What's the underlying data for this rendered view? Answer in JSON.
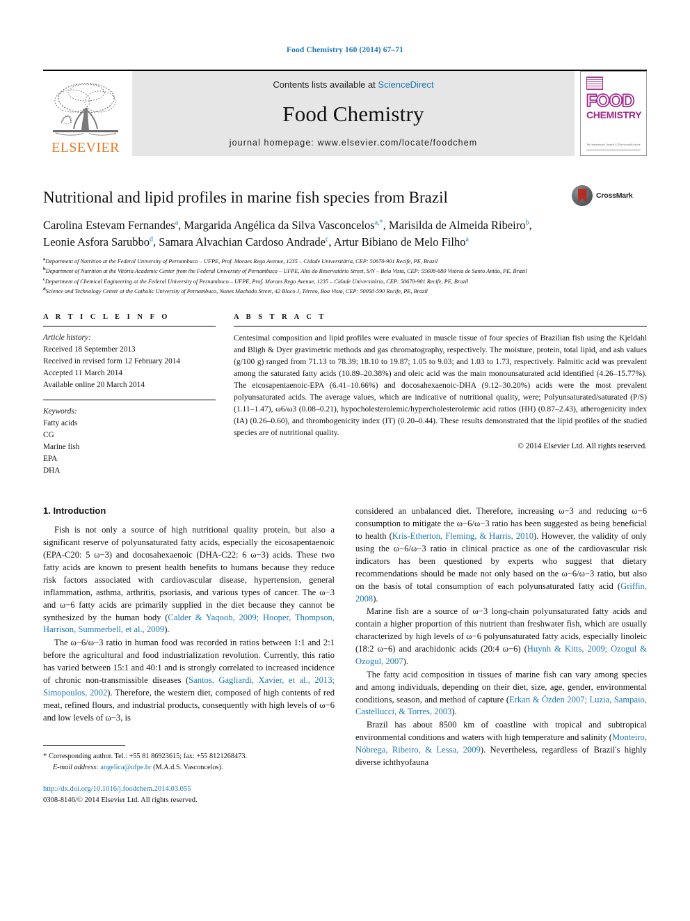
{
  "running_head": "Food Chemistry 160 (2014) 67–71",
  "banner": {
    "contents_prefix": "Contents lists available at",
    "contents_link": "ScienceDirect",
    "journal_title": "Food Chemistry",
    "homepage": "journal homepage: www.elsevier.com/locate/foodchem",
    "publisher_name": "ELSEVIER",
    "cover_title_top": "FOOD",
    "cover_title_bottom": "CHEMISTRY",
    "cover_footer": "An International Journal\nA Elsevier publication"
  },
  "article": {
    "title": "Nutritional and lipid profiles in marine fish species from Brazil",
    "crossmark_label": "CrossMark",
    "authors_line1": "Carolina Estevam Fernandes a, Margarida Angélica da Silva Vasconcelos a,*, Marisilda de Almeida Ribeiro b,",
    "authors_line2": "Leonie Asfora Sarubbo d, Samara Alvachian Cardoso Andrade c, Artur Bibiano de Melo Filho a",
    "authors": [
      {
        "name": "Carolina Estevam Fernandes",
        "sup": "a"
      },
      {
        "name": "Margarida Angélica da Silva Vasconcelos",
        "sup": "a,*"
      },
      {
        "name": "Marisilda de Almeida Ribeiro",
        "sup": "b"
      },
      {
        "name": "Leonie Asfora Sarubbo",
        "sup": "d"
      },
      {
        "name": "Samara Alvachian Cardoso Andrade",
        "sup": "c"
      },
      {
        "name": "Artur Bibiano de Melo Filho",
        "sup": "a"
      }
    ],
    "affiliations": [
      {
        "mark": "a",
        "text": "Department of Nutrition at the Federal University of Pernambuco – UFPE, Prof. Moraes Rego Avenue, 1235 – Cidade Universitária, CEP: 50670-901 Recife, PE, Brazil"
      },
      {
        "mark": "b",
        "text": "Department of Nutrition at the Vitória Academic Center from the Federal University of Pernambuco – UFPE, Alto do Reservatório Street, S/N – Bela Vista, CEP: 55608-680 Vitória de Santo Antão, PE, Brazil"
      },
      {
        "mark": "c",
        "text": "Department of Chemical Engineering at the Federal University of Pernambuco – UFPE, Prof. Moraes Rego Avenue, 1235 – Cidade Universitária, CEP: 50670-901 Recife, PE, Brazil"
      },
      {
        "mark": "d",
        "text": "Science and Technology Center at the Catholic University of Pernambuco, Nunes Machado Street, 42 Bloco J, Térreo, Boa Vista, CEP: 50050-590 Recife, PE, Brazil"
      }
    ]
  },
  "article_info": {
    "heading": "A R T I C L E    I N F O",
    "history_label": "Article history:",
    "history": [
      "Received 18 September 2013",
      "Received in revised form 12 February 2014",
      "Accepted 11 March 2014",
      "Available online 20 March 2014"
    ],
    "keywords_label": "Keywords:",
    "keywords": [
      "Fatty acids",
      "CG",
      "Marine fish",
      "EPA",
      "DHA"
    ]
  },
  "abstract": {
    "heading": "A B S T R A C T",
    "text": "Centesimal composition and lipid profiles were evaluated in muscle tissue of four species of Brazilian fish using the Kjeldahl and Bligh & Dyer gravimetric methods and gas chromatography, respectively. The moisture, protein, total lipid, and ash values (g/100 g) ranged from 71.13 to 78.39; 18.10 to 19.87; 1.05 to 9.03; and 1.03 to 1.73, respectively. Palmitic acid was prevalent among the saturated fatty acids (10.89–20.38%) and oleic acid was the main monounsaturated acid identified (4.26–15.77%). The eicosapentaenoic-EPA (6.41–10.66%) and docosahexaenoic-DHA (9.12–30.20%) acids were the most prevalent polyunsaturated acids. The average values, which are indicative of nutritional quality, were; Polyunsaturated/saturated (P/S) (1.11–1.47), ω6/ω3 (0.08–0.21), hypocholesterolemic/hypercholesterolemic acid ratios (HH) (0.87–2.43), atherogenicity index (IA) (0.26–0.60), and thrombogenicity index (IT) (0.20–0.44). These results demonstrated that the lipid profiles of the studied species are of nutritional quality.",
    "copyright": "© 2014 Elsevier Ltd. All rights reserved."
  },
  "body": {
    "section_heading": "1. Introduction",
    "left_paragraphs": [
      "Fish is not only a source of high nutritional quality protein, but also a significant reserve of polyunsaturated fatty acids, especially the eicosapentaenoic (EPA-C20: 5 ω−3) and docosahexaenoic (DHA-C22: 6 ω−3) acids. These two fatty acids are known to present health benefits to humans because they reduce risk factors associated with cardiovascular disease, hypertension, general inflammation, asthma, arthritis, psoriasis, and various types of cancer. The ω−3 and ω−6 fatty acids are primarily supplied in the diet because they cannot be synthesized by the human body (Calder & Yaqoob, 2009; Hooper, Thompson, Harrison, Summerbell, et al., 2009).",
      "The ω−6/ω−3 ratio in human food was recorded in ratios between 1:1 and 2:1 before the agricultural and food industrialization revolution. Currently, this ratio has varied between 15:1 and 40:1 and is strongly correlated to increased incidence of chronic non-transmissible diseases (Santos, Gagliardi, Xavier, et al., 2013; Simopoulos, 2002). Therefore, the western diet, composed of high contents of red meat, refined flours, and industrial products, consequently with high levels of ω−6 and low levels of ω−3, is"
    ],
    "right_paragraphs": [
      "considered an unbalanced diet. Therefore, increasing ω−3 and reducing ω−6 consumption to mitigate the ω−6/ω−3 ratio has been suggested as being beneficial to health (Kris-Etherton, Fleming, & Harris, 2010). However, the validity of only using the ω−6/ω−3 ratio in clinical practice as one of the cardiovascular risk indicators has been questioned by experts who suggest that dietary recommendations should be made not only based on the ω−6/ω−3 ratio, but also on the basis of total consumption of each polyunsaturated fatty acid (Griffin, 2008).",
      "Marine fish are a source of ω−3 long-chain polyunsaturated fatty acids and contain a higher proportion of this nutrient than freshwater fish, which are usually characterized by high levels of ω−6 polyunsaturated fatty acids, especially linoleic (18:2 ω−6) and arachidonic acids (20:4 ω−6) (Huynh & Kitts, 2009; Ozogul & Ozogul, 2007).",
      "The fatty acid composition in tissues of marine fish can vary among species and among individuals, depending on their diet, size, age, gender, environmental conditions, season, and method of capture (Erkan & Özden 2007; Luzia, Sampaio, Castellucci, & Torres, 2003).",
      "Brazil has about 8500 km of coastline with tropical and subtropical environmental conditions and waters with high temperature and salinity (Monteiro, Nóbrega, Ribeiro, & Lessa, 2009). Nevertheless, regardless of Brazil's highly diverse ichthyofauna"
    ]
  },
  "footnotes": {
    "corresponding": "Corresponding author. Tel.: +55 81 86923615; fax: +55 8121268473.",
    "email_label": "E-mail address:",
    "email": "angelica@ufpe.br",
    "email_owner": "(M.A.d.S. Vasconcelos).",
    "doi": "http://dx.doi.org/10.1016/j.foodchem.2014.03.055",
    "issn": "0308-8146/© 2014 Elsevier Ltd. All rights reserved."
  },
  "colors": {
    "link": "#1c76b0",
    "elsevier_orange": "#E87722",
    "cover_magenta": "#a0268c"
  }
}
